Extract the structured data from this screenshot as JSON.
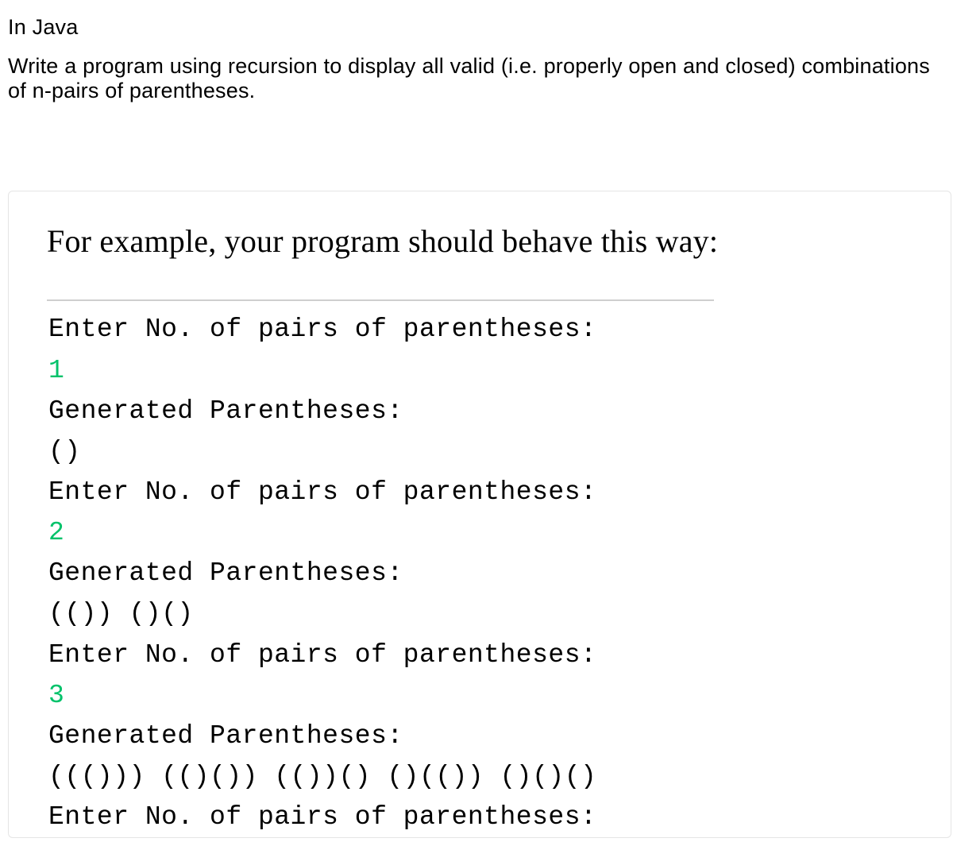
{
  "intro": "In Java",
  "description": "Write a program using recursion to display all valid (i.e. properly open and closed) combinations of n-pairs of parentheses.",
  "example_heading": "For example, your program should behave this way:",
  "terminal": {
    "prompt": "Enter No. of pairs of parentheses:",
    "generated_label": "Generated Parentheses:",
    "runs": [
      {
        "input": "1",
        "output": "()"
      },
      {
        "input": "2",
        "output": "(()) ()()"
      },
      {
        "input": "3",
        "output": "((())) (()()) (())() ()(()) ()()()"
      }
    ]
  }
}
